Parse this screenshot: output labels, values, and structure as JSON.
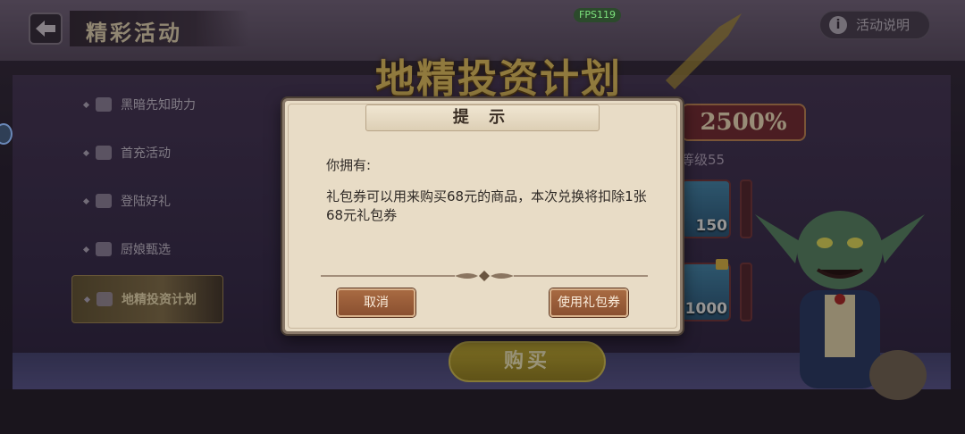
{
  "header": {
    "back_icon": "arrow-left-icon",
    "title": "精彩活动",
    "fps": "FPS119",
    "info_icon": "info-icon",
    "info_glyph": "i",
    "info_label": "活动说明"
  },
  "sidebar": {
    "items": [
      {
        "label": "黑暗先知助力",
        "icon": "bat-icon"
      },
      {
        "label": "首充活动",
        "icon": "gift-icon"
      },
      {
        "label": "登陆好礼",
        "icon": "present-icon"
      },
      {
        "label": "厨娘甄选",
        "icon": "spoon-icon"
      },
      {
        "label": "地精投资计划",
        "icon": "chart-icon",
        "active": true
      }
    ]
  },
  "banner": {
    "title": "地精投资计划",
    "percent": "2500%",
    "level": "等级55",
    "rewards": [
      "150",
      "1000"
    ],
    "buy_label": "购买"
  },
  "dialog": {
    "title": "提 示",
    "line1": "你拥有:",
    "line2": "礼包券可以用来购买68元的商品，本次兑换将扣除1张68元礼包券",
    "cancel_label": "取消",
    "confirm_label": "使用礼包券"
  },
  "colors": {
    "dialog_bg": "#e8dcc6",
    "button_brown": "#a86a42",
    "gold_title": "#e9c664",
    "fps_green": "#7de27d"
  }
}
